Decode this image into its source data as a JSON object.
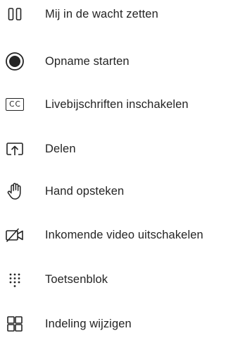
{
  "menu": {
    "items": [
      {
        "label": "Mij in de wacht zetten",
        "icon": "pause-icon"
      },
      {
        "label": "Opname starten",
        "icon": "record-icon"
      },
      {
        "label": "Livebijschriften inschakelen",
        "icon": "closed-captions-icon"
      },
      {
        "label": "Delen",
        "icon": "share-screen-icon"
      },
      {
        "label": "Hand opsteken",
        "icon": "raise-hand-icon"
      },
      {
        "label": "Inkomende video uitschakelen",
        "icon": "video-off-icon"
      },
      {
        "label": "Toetsenblok",
        "icon": "dialpad-icon"
      },
      {
        "label": "Indeling wijzigen",
        "icon": "layout-grid-icon"
      }
    ],
    "cc_text": "CC"
  }
}
